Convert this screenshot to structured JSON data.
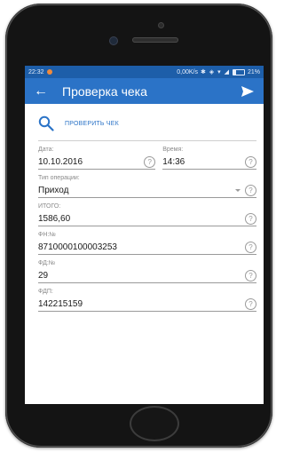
{
  "status_bar": {
    "time": "22:32",
    "network_speed": "0,00K/s",
    "battery_percent": "21%",
    "battery_level": 0.21
  },
  "app_bar": {
    "title": "Проверка чека"
  },
  "check": {
    "label": "ПРОВЕРИТЬ ЧЕК"
  },
  "fields": {
    "date": {
      "label": "Дата:",
      "value": "10.10.2016"
    },
    "time": {
      "label": "Время:",
      "value": "14:36"
    },
    "operation_type": {
      "label": "Тип операции:",
      "value": "Приход"
    },
    "total": {
      "label": "ИТОГО:",
      "value": "1586,60"
    },
    "fn": {
      "label": "ФН:№",
      "value": "8710000100003253"
    },
    "fd": {
      "label": "ФД:№",
      "value": "29"
    },
    "fdp": {
      "label": "ФДП:",
      "value": "142215159"
    }
  },
  "help_glyph": "?",
  "icons": [
    "back-arrow-icon",
    "send-icon",
    "search-icon",
    "help-icon",
    "dropdown-arrow-icon"
  ],
  "colors": {
    "status_bar": "#1d5ea9",
    "app_bar": "#2b73c7",
    "accent": "#2b73c7",
    "device": "#141414"
  }
}
